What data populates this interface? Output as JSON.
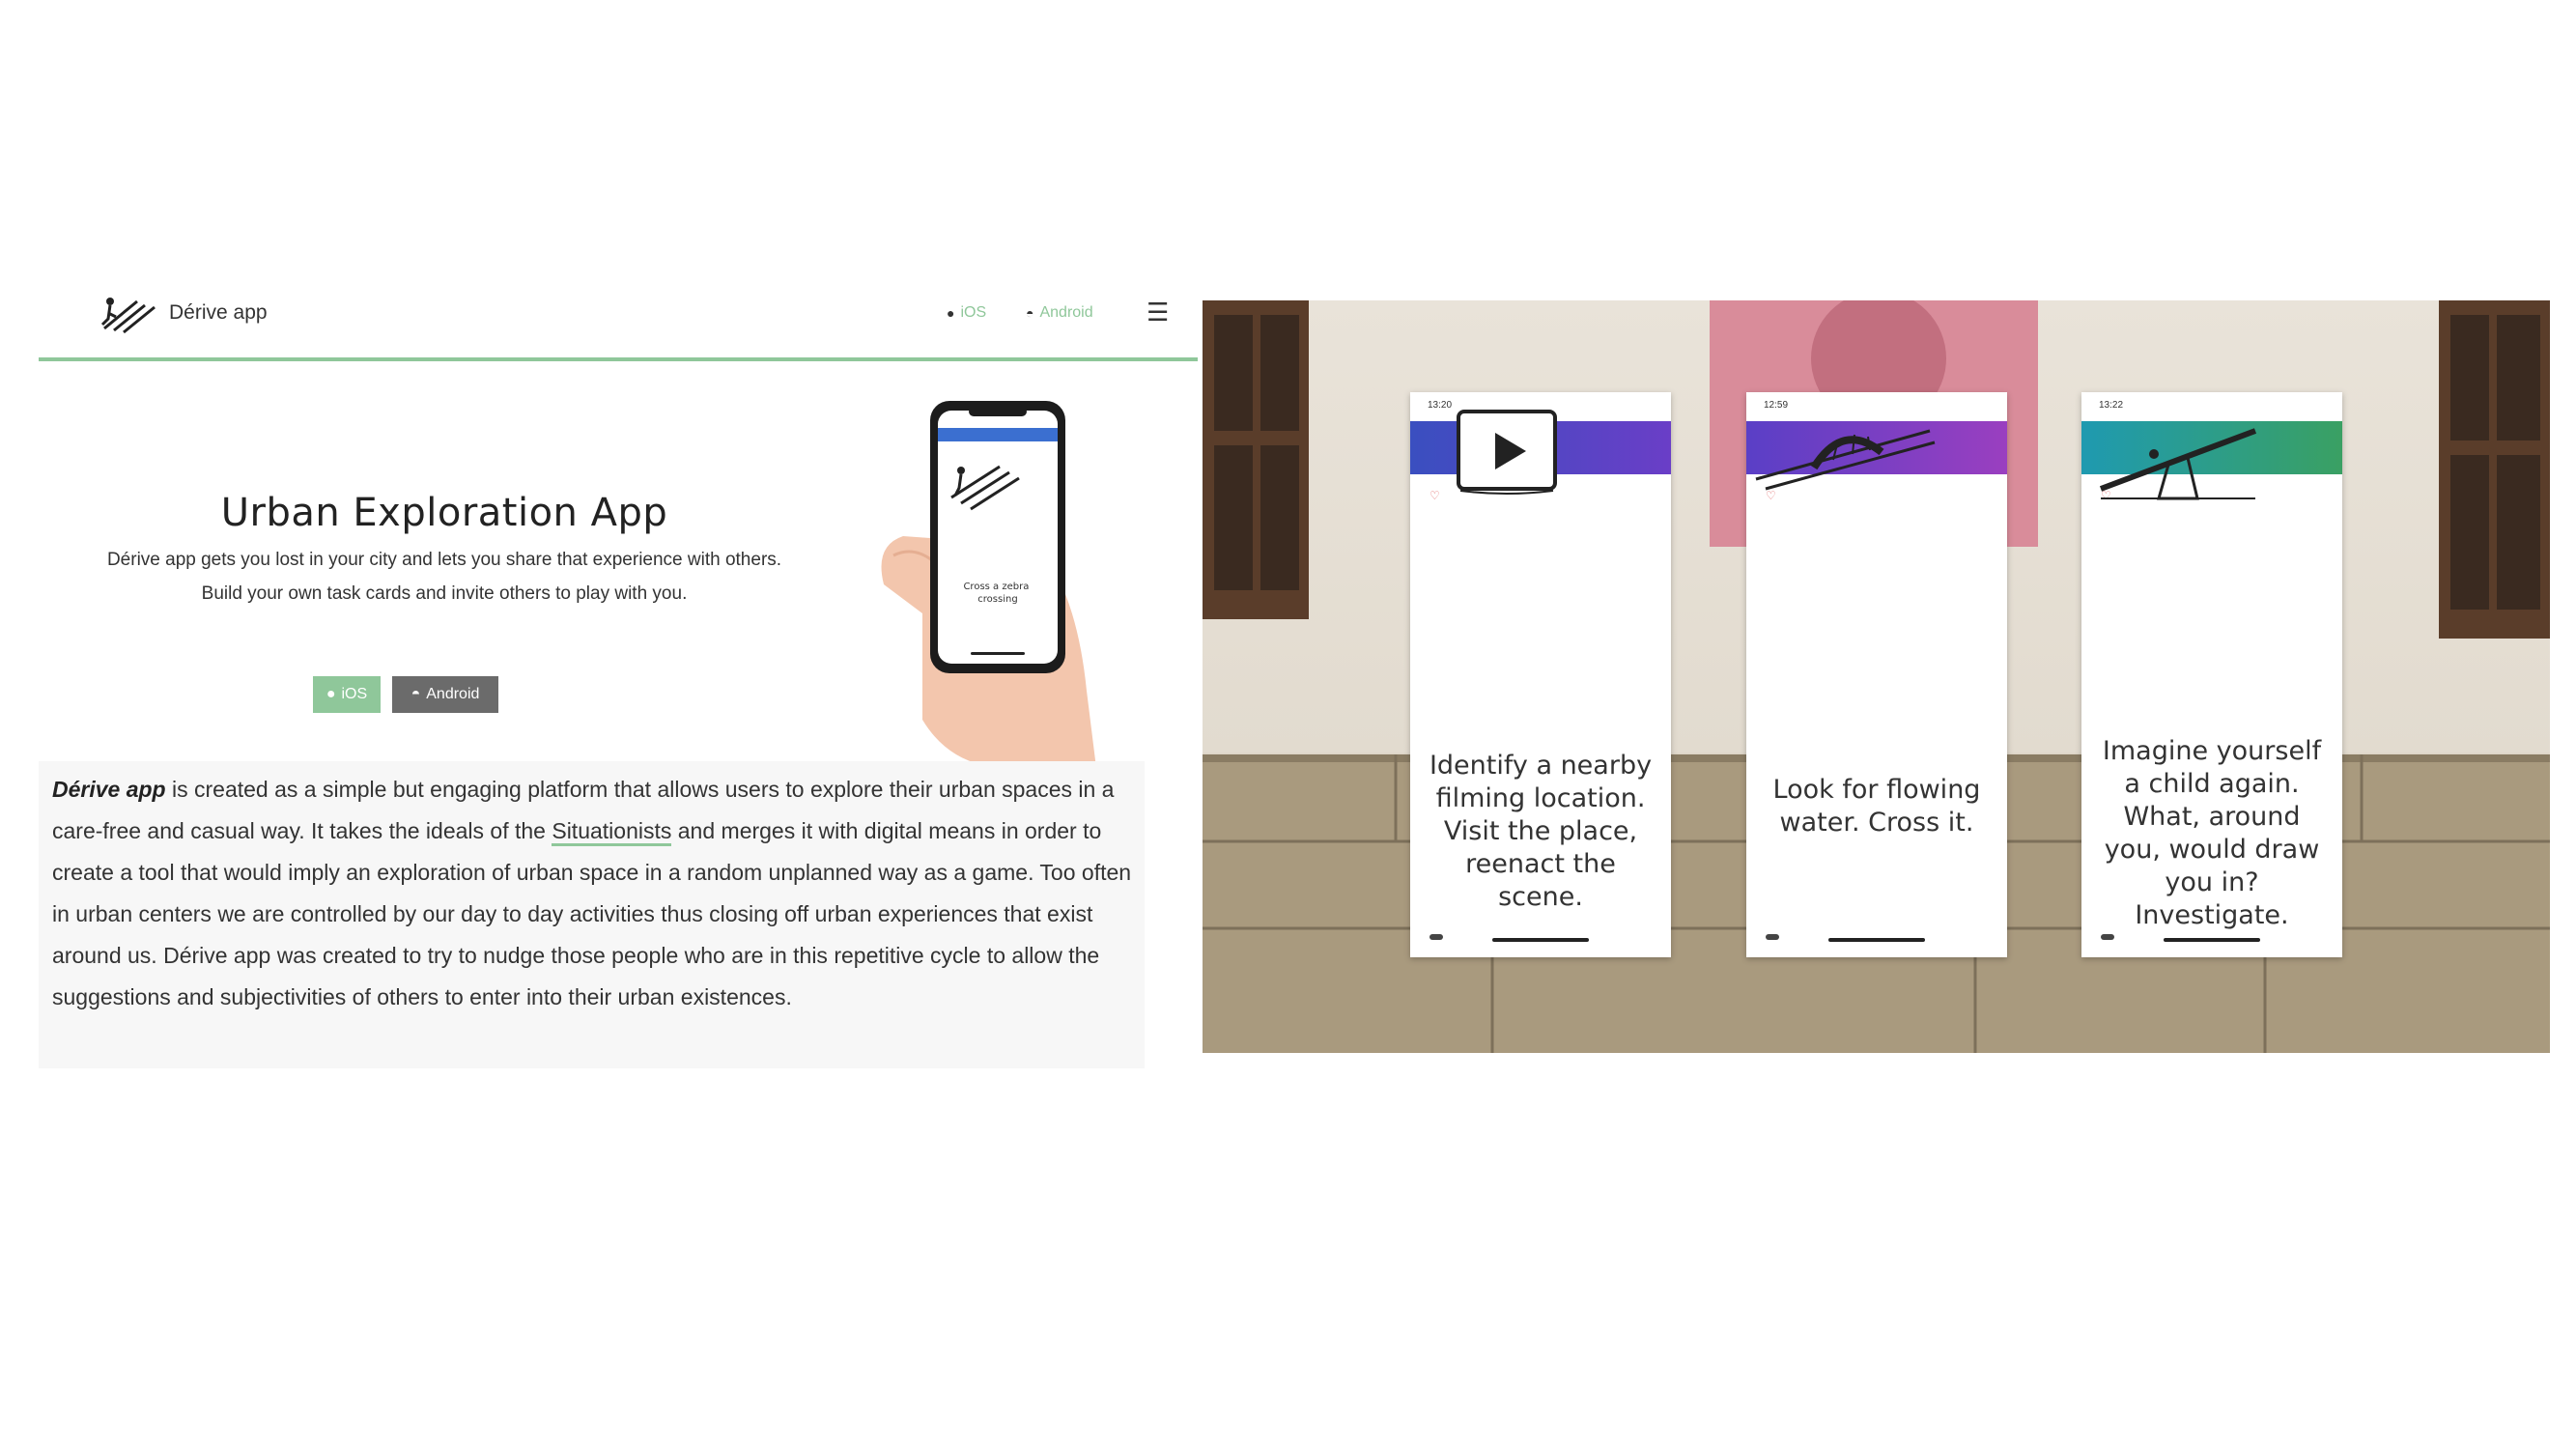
{
  "site": {
    "brand": "Dérive app",
    "nav": {
      "ios_label": "iOS",
      "android_label": "Android"
    },
    "hero": {
      "title": "Urban Exploration App",
      "text": "Dérive app gets you lost in your city and lets you share that experience with others. Build your own task cards and invite others to play with you.",
      "ios_button": "iOS",
      "android_button": "Android",
      "phone_card_text": "Cross a zebra crossing"
    },
    "about": {
      "app_name": "Dérive app",
      "part1": " is created as a simple but engaging platform that allows users to explore their urban spaces in a care-free and casual way. It takes the ideals of the ",
      "link": "Situationists",
      "part2": " and merges it with digital means in order to create a tool that would imply an exploration of urban space in a random unplanned way as a game. Too often in urban centers we are controlled by our day to day activities thus closing off urban experiences that exist around us. Dérive app was created to try to nudge those people who are in this repetitive cycle to allow the suggestions and subjectivities of others to enter into their urban existences."
    },
    "colors": {
      "accent": "#8fc79a",
      "android_button": "#6b6b6b"
    }
  },
  "photo": {
    "cards": [
      {
        "time": "13:20",
        "bar_color": "#4a5fc6",
        "task": "Identify a nearby filming location. Visit the place, reenact the scene.",
        "icon": "play-icon"
      },
      {
        "time": "12:59",
        "bar_color": "#8e3fc0",
        "task": "Look for flowing water. Cross it.",
        "icon": "bridge-icon"
      },
      {
        "time": "13:22",
        "bar_color": "#2e9b86",
        "task": "Imagine yourself a child again. What, around you, would draw you in? Investigate.",
        "icon": "seesaw-icon"
      }
    ]
  }
}
